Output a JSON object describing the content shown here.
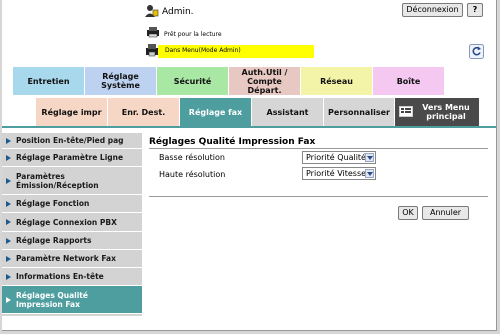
{
  "header": {
    "user_label": "Admin.",
    "logout_label": "Déconnexion",
    "help_label": "?",
    "status_text": "Prêt pour la lecture",
    "mode_text": "Dans Menu(Mode Admin)"
  },
  "tabs": [
    {
      "label": "Entretien",
      "color": "#a8d8ec"
    },
    {
      "label": "Réglage Système",
      "color": "#bcd2f0"
    },
    {
      "label": "Sécurité",
      "color": "#a8e8a4"
    },
    {
      "label": "Auth.Util / Compte Départ.",
      "color": "#e8c8c2"
    },
    {
      "label": "Réseau",
      "color": "#f4f4a8"
    },
    {
      "label": "Boîte",
      "color": "#f4c8f0"
    }
  ],
  "subtabs": [
    {
      "label": "Réglage impr",
      "color": "#f6d6c4"
    },
    {
      "label": "Enr. Dest.",
      "color": "#f6d6c4"
    },
    {
      "label": "Réglage fax",
      "color": "#4e9ea0"
    },
    {
      "label": "Assistant",
      "color": "#d6d6d6"
    },
    {
      "label": "Personnaliser",
      "color": "#d6d6d6"
    },
    {
      "label": "Vers Menu principal",
      "color": "#4a4a4a"
    }
  ],
  "sidebar": {
    "items": [
      {
        "label": "Position En-tête/Pied pag",
        "active": false
      },
      {
        "label": "Réglage Paramètre Ligne",
        "active": false
      },
      {
        "label": "Paramètres Émission/Réception",
        "active": false
      },
      {
        "label": "Réglage Fonction",
        "active": false
      },
      {
        "label": "Réglage Connexion PBX",
        "active": false
      },
      {
        "label": "Réglage Rapports",
        "active": false
      },
      {
        "label": "Paramètre Network Fax",
        "active": false
      },
      {
        "label": "Informations En-tête",
        "active": false
      },
      {
        "label": "Réglages Qualité Impression Fax",
        "active": true
      }
    ]
  },
  "main": {
    "title": "Réglages Qualité Impression Fax",
    "rows": [
      {
        "label": "Basse résolution",
        "value": "Priorité Qualité"
      },
      {
        "label": "Haute résolution",
        "value": "Priorité Vitesse"
      }
    ],
    "ok_label": "OK",
    "cancel_label": "Annuler"
  }
}
